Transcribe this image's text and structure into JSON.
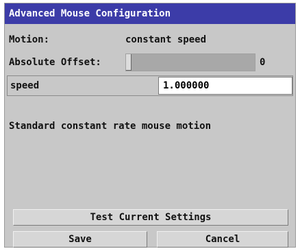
{
  "window": {
    "title": "Advanced Mouse Configuration"
  },
  "motion": {
    "label": "Motion:",
    "value": "constant speed"
  },
  "absolute_offset": {
    "label": "Absolute Offset:",
    "value_text": "0",
    "level": 0
  },
  "speed": {
    "label": "speed",
    "value": "1.000000"
  },
  "description": "Standard constant rate mouse motion",
  "buttons": {
    "test": "Test Current Settings",
    "save": "Save",
    "cancel": "Cancel"
  },
  "colors": {
    "title_bar": "#3c3ca8",
    "panel": "#c8c8c8",
    "slider_track": "#a8a8a8"
  }
}
